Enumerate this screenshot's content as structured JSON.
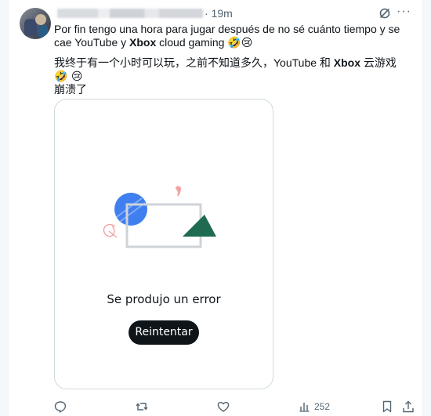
{
  "tweet": {
    "time": "· 19m",
    "text_es_before": "Por fin tengo una hora para jugar después de no sé cuánto tiempo y se cae YouTube y ",
    "text_es_bold": "Xbox",
    "text_es_after": " cloud gaming ",
    "text_es_emoji": "🤣😢",
    "text_zh_before": "我终于有一个小时可以玩，之前不知道多久，YouTube 和 ",
    "text_zh_bold": "Xbox",
    "text_zh_after": " 云游戏 ",
    "text_zh_emoji": "🤣 😢",
    "text_zh_line2": "崩溃了"
  },
  "media": {
    "error_message": "Se produjo un error",
    "retry_label": "Reintentar"
  },
  "actions": {
    "views_count": "252"
  },
  "colors": {
    "blue_circle": "#3f7ff0",
    "green_triangle": "#1f6b52",
    "pink_accent": "#f0a3a3",
    "button_bg": "#0f1419"
  },
  "icons": [
    "grok-icon",
    "more-icon",
    "reply-icon",
    "retweet-icon",
    "like-icon",
    "views-icon",
    "bookmark-icon",
    "share-icon"
  ]
}
